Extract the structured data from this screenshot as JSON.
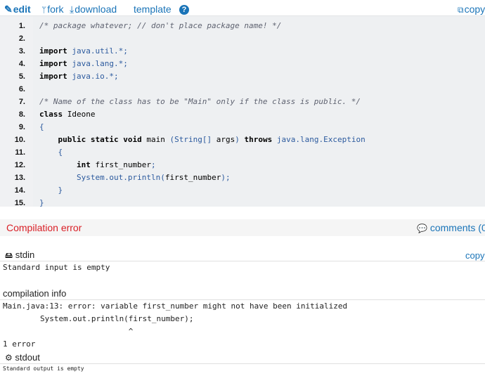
{
  "toolbar": {
    "edit": "edit",
    "fork": "fork",
    "download": "download",
    "template": "template",
    "help": "?",
    "copy": "copy"
  },
  "code": {
    "lines": [
      {
        "n": "1.",
        "text": "/* package whatever; // don't place package name! */",
        "kind": "comment"
      },
      {
        "n": "2.",
        "text": "",
        "kind": "plain"
      },
      {
        "n": "3.",
        "text": "import java.util.*;",
        "kind": "import"
      },
      {
        "n": "4.",
        "text": "import java.lang.*;",
        "kind": "import"
      },
      {
        "n": "5.",
        "text": "import java.io.*;",
        "kind": "import"
      },
      {
        "n": "6.",
        "text": "",
        "kind": "plain"
      },
      {
        "n": "7.",
        "text": "/* Name of the class has to be \"Main\" only if the class is public. */",
        "kind": "comment"
      },
      {
        "n": "8.",
        "text": "class Ideone",
        "kind": "class"
      },
      {
        "n": "9.",
        "text": "{",
        "kind": "brace"
      },
      {
        "n": "10.",
        "text": "    public static void main (String[] args) throws java.lang.Exception",
        "kind": "main"
      },
      {
        "n": "11.",
        "text": "    {",
        "kind": "brace"
      },
      {
        "n": "12.",
        "text": "        int first_number;",
        "kind": "int"
      },
      {
        "n": "13.",
        "text": "        System.out.println(first_number);",
        "kind": "sys"
      },
      {
        "n": "14.",
        "text": "    }",
        "kind": "brace"
      },
      {
        "n": "15.",
        "text": "}",
        "kind": "brace"
      }
    ]
  },
  "status": {
    "label": "Compilation error",
    "comments": "comments (0"
  },
  "stdin": {
    "title": "stdin",
    "copy": "copy",
    "content": "Standard input is empty"
  },
  "compilation": {
    "title": "compilation info",
    "content": "Main.java:13: error: variable first_number might not have been initialized\n        System.out.println(first_number);\n                           ^\n1 error"
  },
  "stdout": {
    "title": "stdout",
    "content": "Standard output is empty"
  },
  "colors": {
    "link": "#1a74b8",
    "error": "#d91f26",
    "code_bg": "#eef0f2"
  }
}
